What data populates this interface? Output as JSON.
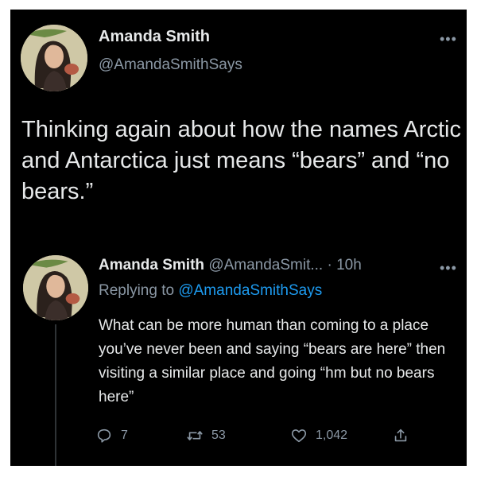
{
  "colors": {
    "background": "#000000",
    "text": "#e7e9ea",
    "secondary": "#8b98a5",
    "link": "#1d9bf0"
  },
  "main_tweet": {
    "display_name": "Amanda Smith",
    "handle": "@AmandaSmithSays",
    "more_icon": "more-horizontal-icon",
    "text": "Thinking again about how the names Arctic and Antarctica just means “bears” and “no bears.”"
  },
  "reply_tweet": {
    "display_name": "Amanda Smith",
    "handle": "@AmandaSmit...",
    "separator": "·",
    "time": "10h",
    "more_icon": "more-horizontal-icon",
    "replying_prefix": "Replying to",
    "replying_to": "@AmandaSmithSays",
    "text": "What can be more human than coming to a place you’ve never been and saying “bears are here” then visiting a similar place and going “hm but no bears here”",
    "actions": {
      "reply_count": "7",
      "retweet_count": "53",
      "like_count": "1,042"
    }
  }
}
